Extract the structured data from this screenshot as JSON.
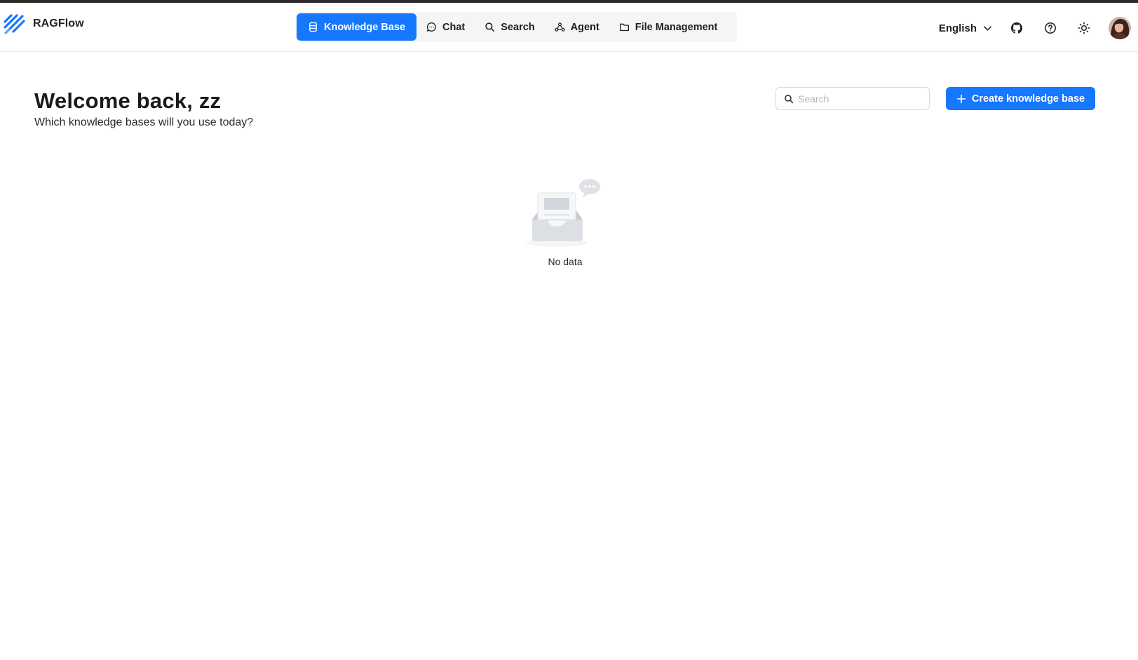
{
  "app": {
    "name": "RAGFlow"
  },
  "nav": {
    "items": [
      {
        "label": "Knowledge Base",
        "icon": "database-icon",
        "active": true
      },
      {
        "label": "Chat",
        "icon": "chat-bubble-icon",
        "active": false
      },
      {
        "label": "Search",
        "icon": "search-icon",
        "active": false
      },
      {
        "label": "Agent",
        "icon": "agent-graph-icon",
        "active": false
      },
      {
        "label": "File Management",
        "icon": "folder-icon",
        "active": false
      }
    ]
  },
  "header": {
    "language": "English",
    "icons": [
      "github-icon",
      "help-icon",
      "sun-icon"
    ]
  },
  "main": {
    "title": "Welcome back, zz",
    "subtitle": "Which knowledge bases will you use today?",
    "search": {
      "placeholder": "Search",
      "value": ""
    },
    "create_label": "Create knowledge base",
    "empty_text": "No data"
  },
  "colors": {
    "accent": "#1677ff",
    "text": "#1f1f1f",
    "muted": "#b5b5b5"
  }
}
